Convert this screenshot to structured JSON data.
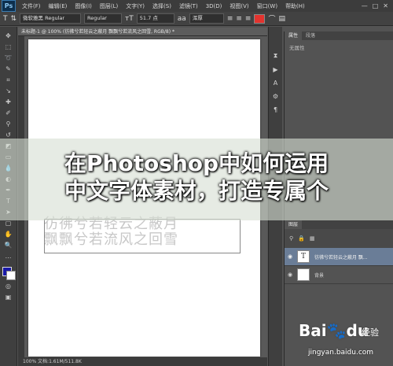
{
  "app": {
    "logo": "Ps",
    "menu": [
      "文件(F)",
      "编辑(E)",
      "图像(I)",
      "图层(L)",
      "文字(Y)",
      "选择(S)",
      "滤镜(T)",
      "3D(D)",
      "视图(V)",
      "窗口(W)",
      "帮助(H)"
    ],
    "window_controls": [
      "—",
      "□",
      "✕"
    ]
  },
  "options_bar": {
    "font_family": "微软雅黑 Regular",
    "font_style": "Regular",
    "font_size": "51.7 点",
    "antialias": "浑厚",
    "text_color": "#e3332e",
    "icons": [
      "text-tool-icon",
      "text-orientation-icon",
      "font-size-icon",
      "antialias-icon",
      "align-left-icon",
      "align-center-icon",
      "align-right-icon",
      "warp-text-icon",
      "character-panel-icon"
    ]
  },
  "document": {
    "tab_title": "未标题-1 @ 100% (彷彿兮若轻云之蔽月 飘飘兮若流风之回雪, RGB/8) *",
    "canvas_text_line1": "彷彿兮若轻云之蔽月",
    "canvas_text_line2": "飘飘兮若流风之回雪",
    "status": "100%   文档:1.61M/511.8K"
  },
  "tools": [
    "move",
    "marquee",
    "lasso",
    "quick-select",
    "crop",
    "eyedropper",
    "healing",
    "brush",
    "stamp",
    "history-brush",
    "eraser",
    "gradient",
    "blur",
    "dodge",
    "pen",
    "type",
    "path-select",
    "shape",
    "hand",
    "zoom"
  ],
  "properties_panel": {
    "tabs": [
      "属性",
      "段落"
    ],
    "body": "无属性"
  },
  "layers_panel": {
    "tab": "图层",
    "layers": [
      {
        "name": "彷彿兮若轻云之蔽月 飘...",
        "type": "text",
        "selected": true
      },
      {
        "name": "背景",
        "type": "background",
        "selected": false
      }
    ]
  },
  "banner": {
    "line1": "在Photoshop中如何运用",
    "line2": "中文字体素材，打造专属个"
  },
  "watermark": {
    "logo": "Bai",
    "paw": "du",
    "jingyan": "经验",
    "url": "jingyan.baidu.com"
  }
}
